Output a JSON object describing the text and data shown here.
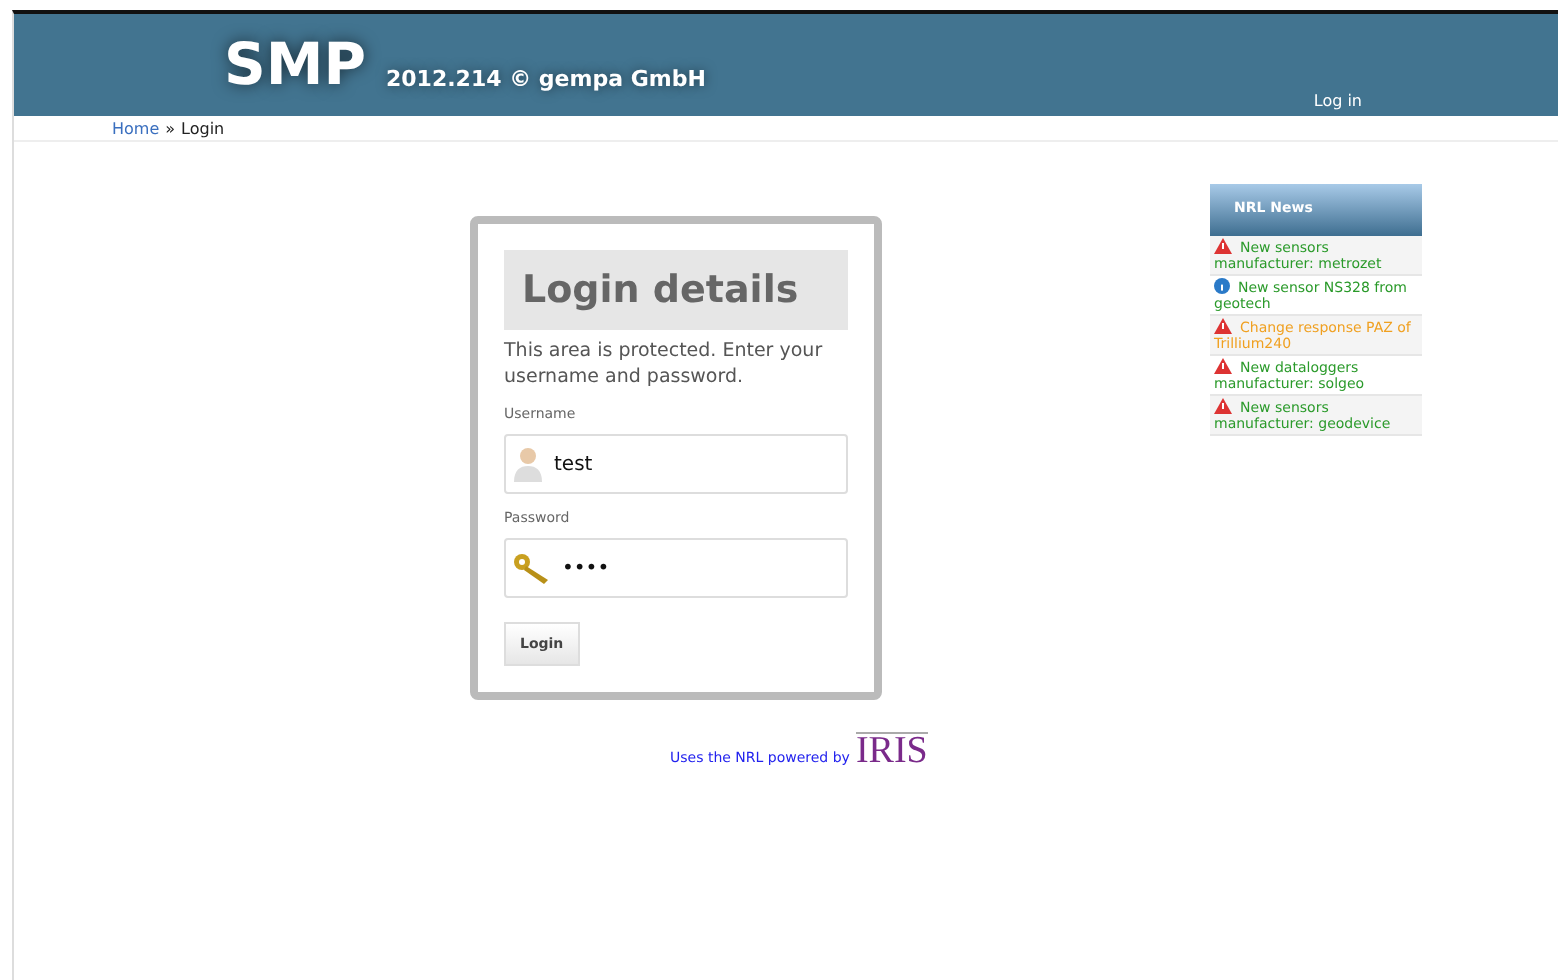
{
  "header": {
    "logo": "SMP",
    "version": "2012.214 © gempa GmbH",
    "login_link": "Log in"
  },
  "breadcrumb": {
    "home": "Home",
    "separator": "»",
    "current": "Login"
  },
  "login": {
    "title": "Login details",
    "intro": "This area is protected. Enter your username and password.",
    "username_label": "Username",
    "username_value": "test",
    "password_label": "Password",
    "password_value": "••••",
    "button": "Login"
  },
  "footer": {
    "text": "Uses the NRL powered by",
    "logo": "IRIS"
  },
  "news": {
    "title": "NRL News",
    "items": [
      {
        "kind": "warning",
        "text": "New sensors manufacturer: metrozet",
        "color": "#2a9a2a"
      },
      {
        "kind": "info",
        "text": "New sensor NS328 from geotech",
        "color": "#2a9a2a"
      },
      {
        "kind": "warning",
        "text": "Change response PAZ of Trillium240",
        "color": "#f0a020"
      },
      {
        "kind": "warning",
        "text": "New dataloggers manufacturer: solgeo",
        "color": "#2a9a2a"
      },
      {
        "kind": "warning",
        "text": "New sensors manufacturer: geodevice",
        "color": "#2a9a2a"
      }
    ]
  }
}
